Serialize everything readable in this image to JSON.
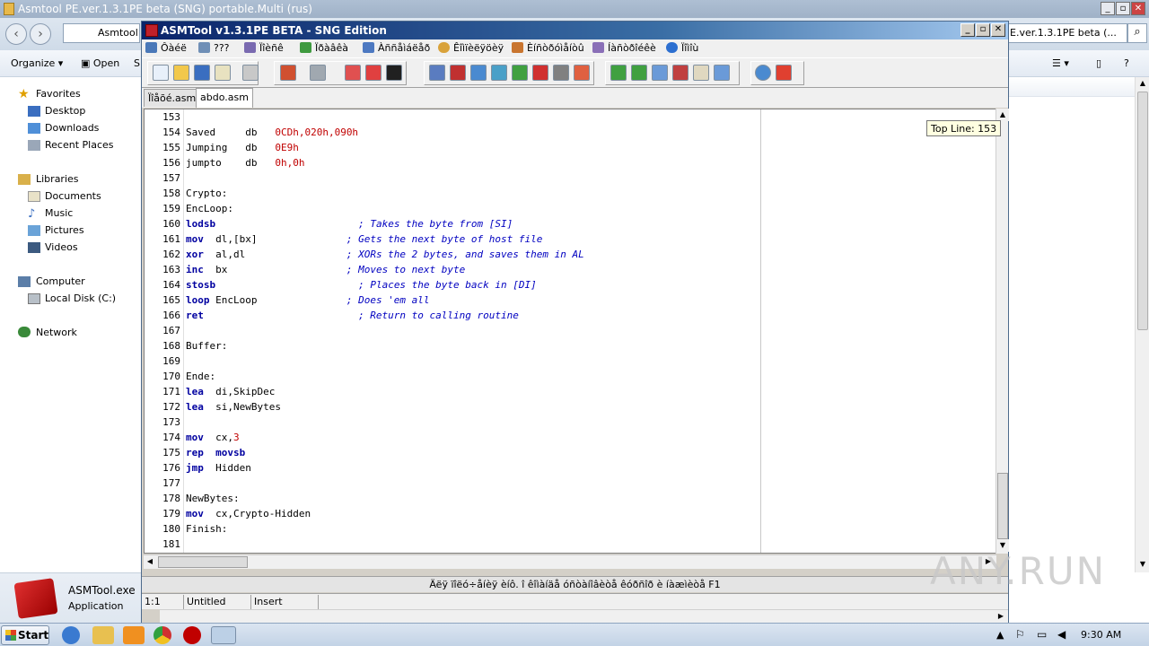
{
  "explorer": {
    "title": "Asmtool PE.ver.1.3.1PE beta (SNG) portable.Multi (rus)",
    "address_left": "Asmtool P",
    "address_right": "E.ver.1.3.1PE beta (...",
    "commands": {
      "organize": "Organize",
      "open": "Open",
      "share_trunc": "S"
    },
    "nav": {
      "favorites": "Favorites",
      "favorites_items": [
        "Desktop",
        "Downloads",
        "Recent Places"
      ],
      "libraries": "Libraries",
      "libraries_items": [
        "Documents",
        "Music",
        "Pictures",
        "Videos"
      ],
      "computer": "Computer",
      "computer_items": [
        "Local Disk (C:)"
      ],
      "network": "Network"
    },
    "details": {
      "name": "ASMTool.exe",
      "type": "Application"
    },
    "window_buttons": {
      "min": "_",
      "max": "▫",
      "close": "✕"
    }
  },
  "app": {
    "title": "ASMTool v1.3.1PE BETA - SNG Edition",
    "menu": [
      "Ôàéë",
      "???",
      "Ïîèñê",
      "Ïðàâêà",
      "Àññåìáëåð",
      "Êîìïèëÿöèÿ",
      "Èíñòðóìåíòû",
      "Íàñòðîéêè",
      "Ïîìîù"
    ],
    "menu_colors": [
      "#4a78b8",
      "#6f8fb6",
      "#7a6ab0",
      "#3f9a3f",
      "#4d79c1",
      "#d9a23a",
      "#c9752f",
      "#8a6fb7",
      "#2c6fd0"
    ],
    "tabs": [
      "Ïîåõé.asm",
      "abdo.asm"
    ],
    "tooltip": "Top Line: 153",
    "hint": "Äëÿ ïîëó÷åíèÿ èíô. î êîìàíäå óñòàíîâèòå êóðñîð è íàæìèòå F1",
    "status": {
      "pos": "1:1",
      "file": "Untitled",
      "mode": "Insert"
    }
  },
  "code_lines": [
    {
      "n": "153",
      "parts": []
    },
    {
      "n": "154",
      "parts": [
        {
          "t": "Saved     db   ",
          "c": ""
        },
        {
          "t": "0CDh,020h,090h",
          "c": "num"
        }
      ]
    },
    {
      "n": "155",
      "parts": [
        {
          "t": "Jumping   db   ",
          "c": ""
        },
        {
          "t": "0E9h",
          "c": "num"
        }
      ]
    },
    {
      "n": "156",
      "parts": [
        {
          "t": "jumpto    db   ",
          "c": ""
        },
        {
          "t": "0h,0h",
          "c": "num"
        }
      ]
    },
    {
      "n": "157",
      "parts": []
    },
    {
      "n": "158",
      "parts": [
        {
          "t": "Crypto:",
          "c": ""
        }
      ]
    },
    {
      "n": "159",
      "parts": [
        {
          "t": "EncLoop:",
          "c": ""
        }
      ]
    },
    {
      "n": "160",
      "parts": [
        {
          "t": "lodsb",
          "c": "kw"
        },
        {
          "t": "                        ",
          "c": ""
        },
        {
          "t": "; Takes the byte from [SI]",
          "c": "cm"
        }
      ]
    },
    {
      "n": "161",
      "parts": [
        {
          "t": "mov",
          "c": "kw"
        },
        {
          "t": "  dl,[bx]               ",
          "c": ""
        },
        {
          "t": "; Gets the next byte of host file",
          "c": "cm"
        }
      ]
    },
    {
      "n": "162",
      "parts": [
        {
          "t": "xor",
          "c": "kw"
        },
        {
          "t": "  al,dl                 ",
          "c": ""
        },
        {
          "t": "; XORs the 2 bytes, and saves them in AL",
          "c": "cm"
        }
      ]
    },
    {
      "n": "163",
      "parts": [
        {
          "t": "inc",
          "c": "kw"
        },
        {
          "t": "  bx                    ",
          "c": ""
        },
        {
          "t": "; Moves to next byte",
          "c": "cm"
        }
      ]
    },
    {
      "n": "164",
      "parts": [
        {
          "t": "stosb",
          "c": "kw"
        },
        {
          "t": "                        ",
          "c": ""
        },
        {
          "t": "; Places the byte back in [DI]",
          "c": "cm"
        }
      ]
    },
    {
      "n": "165",
      "parts": [
        {
          "t": "loop",
          "c": "kw"
        },
        {
          "t": " EncLoop               ",
          "c": ""
        },
        {
          "t": "; Does 'em all",
          "c": "cm"
        }
      ]
    },
    {
      "n": "166",
      "parts": [
        {
          "t": "ret",
          "c": "kw"
        },
        {
          "t": "                          ",
          "c": ""
        },
        {
          "t": "; Return to calling routine",
          "c": "cm"
        }
      ]
    },
    {
      "n": "167",
      "parts": []
    },
    {
      "n": "168",
      "parts": [
        {
          "t": "Buffer:",
          "c": ""
        }
      ]
    },
    {
      "n": "169",
      "parts": []
    },
    {
      "n": "170",
      "parts": [
        {
          "t": "Ende:",
          "c": ""
        }
      ]
    },
    {
      "n": "171",
      "parts": [
        {
          "t": "lea",
          "c": "kw"
        },
        {
          "t": "  di,SkipDec",
          "c": ""
        }
      ]
    },
    {
      "n": "172",
      "parts": [
        {
          "t": "lea",
          "c": "kw"
        },
        {
          "t": "  si,NewBytes",
          "c": ""
        }
      ]
    },
    {
      "n": "173",
      "parts": []
    },
    {
      "n": "174",
      "parts": [
        {
          "t": "mov",
          "c": "kw"
        },
        {
          "t": "  cx,",
          "c": ""
        },
        {
          "t": "3",
          "c": "num"
        }
      ]
    },
    {
      "n": "175",
      "parts": [
        {
          "t": "rep",
          "c": "kw"
        },
        {
          "t": "  ",
          "c": ""
        },
        {
          "t": "movsb",
          "c": "kw"
        }
      ]
    },
    {
      "n": "176",
      "parts": [
        {
          "t": "jmp",
          "c": "kw"
        },
        {
          "t": "  Hidden",
          "c": ""
        }
      ]
    },
    {
      "n": "177",
      "parts": []
    },
    {
      "n": "178",
      "parts": [
        {
          "t": "NewBytes:",
          "c": ""
        }
      ]
    },
    {
      "n": "179",
      "parts": [
        {
          "t": "mov",
          "c": "kw"
        },
        {
          "t": "  cx,Crypto-Hidden",
          "c": ""
        }
      ]
    },
    {
      "n": "180",
      "parts": [
        {
          "t": "Finish:",
          "c": ""
        }
      ]
    },
    {
      "n": "181",
      "parts": []
    }
  ],
  "taskbar": {
    "start": "Start",
    "clock": "9:30 AM"
  },
  "watermark": "ANY.RUN"
}
